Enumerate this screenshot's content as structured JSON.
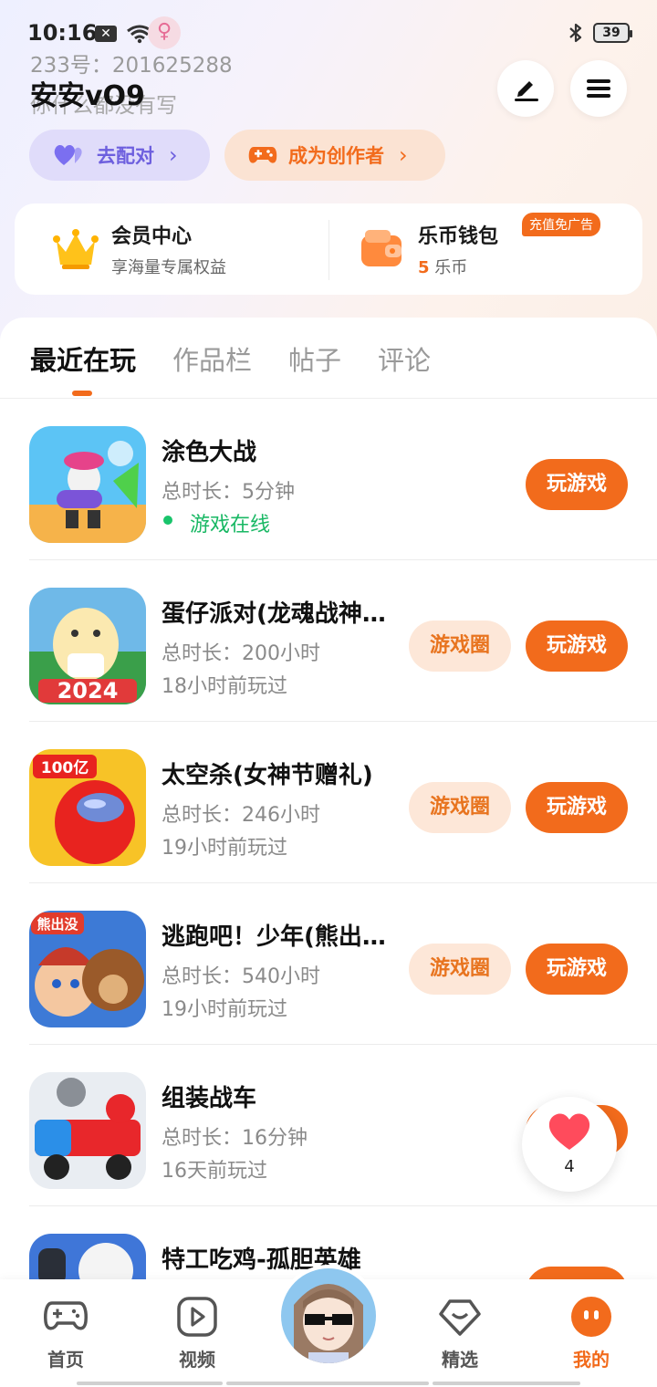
{
  "status_bar": {
    "time": "10:16",
    "x_badge": "✕",
    "battery": "39"
  },
  "profile": {
    "id_line": "233号：201625288",
    "username": "安安vO9",
    "bio": "你什么都没有写",
    "edit_icon": "pencil-icon",
    "menu_icon": "hamburger-icon"
  },
  "pills": {
    "match_label": "去配对",
    "creator_label": "成为创作者"
  },
  "member": {
    "vip_title": "会员中心",
    "vip_sub": "享海量专属权益",
    "wallet_title": "乐币钱包",
    "wallet_amount": "5",
    "wallet_unit": "乐币",
    "recharge_badge": "充值免广告"
  },
  "tabs": [
    "最近在玩",
    "作品栏",
    "帖子",
    "评论"
  ],
  "games": [
    {
      "name": "涂色大战",
      "duration": "总时长：5分钟",
      "status": "游戏在线",
      "online": true,
      "has_circle": false,
      "play": "玩游戏"
    },
    {
      "name": "蛋仔派对(龙魂战神…",
      "duration": "总时长：200小时",
      "status": "18小时前玩过",
      "online": false,
      "has_circle": true,
      "circle": "游戏圈",
      "play": "玩游戏"
    },
    {
      "name": "太空杀(女神节赠礼)",
      "duration": "总时长：246小时",
      "status": "19小时前玩过",
      "online": false,
      "has_circle": true,
      "circle": "游戏圈",
      "play": "玩游戏"
    },
    {
      "name": "逃跑吧！少年(熊出…",
      "duration": "总时长：540小时",
      "status": "19小时前玩过",
      "online": false,
      "has_circle": true,
      "circle": "游戏圈",
      "play": "玩游戏"
    },
    {
      "name": "组装战车",
      "duration": "总时长：16分钟",
      "status": "16天前玩过",
      "online": false,
      "has_circle": false,
      "play": "玩游戏"
    },
    {
      "name": "特工吃鸡-孤胆英雄",
      "duration": "",
      "status": "",
      "online": false,
      "has_circle": false,
      "play": "玩游戏"
    }
  ],
  "icon_labels": {
    "game1": "2024",
    "game2": "100亿",
    "game3": "熊出没"
  },
  "float_like": {
    "count": "4",
    "icon": "heart-icon"
  },
  "nav": {
    "home": "首页",
    "video": "视频",
    "featured": "精选",
    "mine": "我的"
  },
  "colors": {
    "accent": "#f26b1c",
    "accent_light": "#fde7d8",
    "purple": "#6d5fde",
    "online_green": "#19b864"
  }
}
